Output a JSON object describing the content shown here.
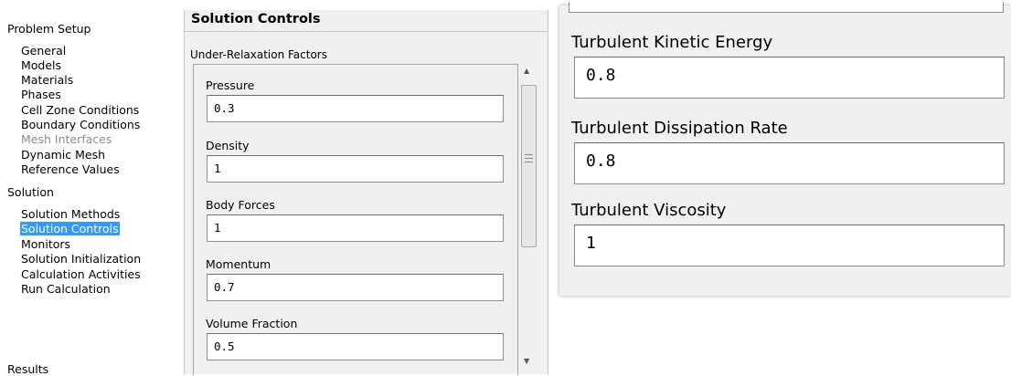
{
  "nav": {
    "sections": [
      {
        "label": "Problem Setup",
        "items": [
          {
            "label": "General"
          },
          {
            "label": "Models"
          },
          {
            "label": "Materials"
          },
          {
            "label": "Phases"
          },
          {
            "label": "Cell Zone Conditions"
          },
          {
            "label": "Boundary Conditions"
          },
          {
            "label": "Mesh Interfaces",
            "disabled": true
          },
          {
            "label": "Dynamic Mesh"
          },
          {
            "label": "Reference Values"
          }
        ]
      },
      {
        "label": "Solution",
        "items": [
          {
            "label": "Solution Methods"
          },
          {
            "label": "Solution Controls",
            "selected": true
          },
          {
            "label": "Monitors"
          },
          {
            "label": "Solution Initialization"
          },
          {
            "label": "Calculation Activities"
          },
          {
            "label": "Run Calculation"
          }
        ]
      },
      {
        "label": "Results",
        "items": []
      }
    ]
  },
  "panel": {
    "title": "Solution Controls",
    "group_title": "Under-Relaxation Factors",
    "fields": [
      {
        "label": "Pressure",
        "value": "0.3"
      },
      {
        "label": "Density",
        "value": "1"
      },
      {
        "label": "Body Forces",
        "value": "1"
      },
      {
        "label": "Momentum",
        "value": "0.7"
      },
      {
        "label": "Volume Fraction",
        "value": "0.5"
      }
    ]
  },
  "zoom": {
    "fields": [
      {
        "label": "Turbulent Kinetic Energy",
        "value": "0.8"
      },
      {
        "label": "Turbulent Dissipation Rate",
        "value": "0.8"
      },
      {
        "label": "Turbulent Viscosity",
        "value": "1"
      }
    ]
  },
  "colors": {
    "selection": "#3399ff",
    "panel_background": "#f0f0f0",
    "disabled_text": "#8d8d8d"
  },
  "icons": {
    "scroll_up": "triangle-up-icon",
    "scroll_down": "triangle-down-icon",
    "thumb_grip": "grip-lines-icon"
  }
}
